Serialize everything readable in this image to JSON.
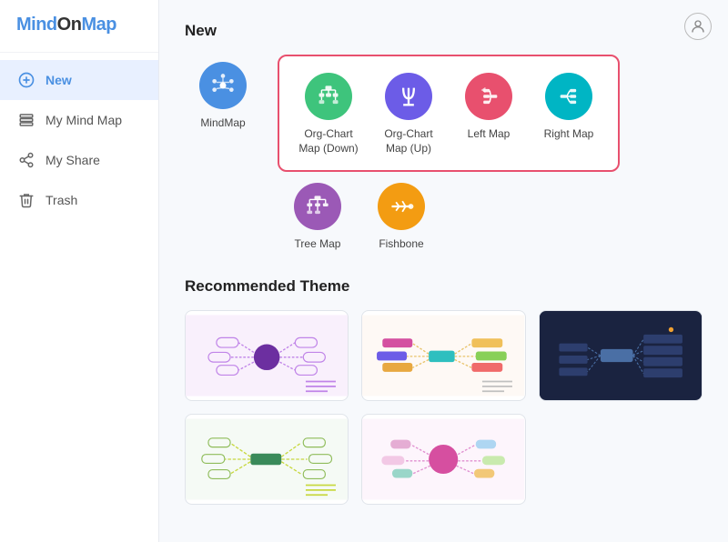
{
  "logo": {
    "brand": "MindOnMap"
  },
  "sidebar": {
    "items": [
      {
        "id": "new",
        "label": "New",
        "icon": "plus-circle",
        "active": true
      },
      {
        "id": "my-mind-map",
        "label": "My Mind Map",
        "icon": "layers",
        "active": false
      },
      {
        "id": "my-share",
        "label": "My Share",
        "icon": "share",
        "active": false
      },
      {
        "id": "trash",
        "label": "Trash",
        "icon": "trash",
        "active": false
      }
    ]
  },
  "main": {
    "new_section_title": "New",
    "templates": [
      {
        "id": "mindmap",
        "label": "MindMap",
        "color": "blue",
        "icon": "mindmap"
      },
      {
        "id": "org-chart-down",
        "label": "Org-Chart Map (Down)",
        "color": "green",
        "icon": "org-down"
      },
      {
        "id": "org-chart-up",
        "label": "Org-Chart Map (Up)",
        "color": "purple",
        "icon": "org-up"
      },
      {
        "id": "left-map",
        "label": "Left Map",
        "color": "pink",
        "icon": "left-map"
      },
      {
        "id": "right-map",
        "label": "Right Map",
        "color": "teal",
        "icon": "right-map"
      },
      {
        "id": "tree-map",
        "label": "Tree Map",
        "color": "violet",
        "icon": "tree-map"
      },
      {
        "id": "fishbone",
        "label": "Fishbone",
        "color": "orange",
        "icon": "fishbone"
      }
    ],
    "recommended_section_title": "Recommended Theme",
    "themes": [
      {
        "id": "theme1",
        "dark": false
      },
      {
        "id": "theme2",
        "dark": false
      },
      {
        "id": "theme3",
        "dark": true
      },
      {
        "id": "theme4",
        "dark": false
      },
      {
        "id": "theme5",
        "dark": false
      }
    ]
  }
}
